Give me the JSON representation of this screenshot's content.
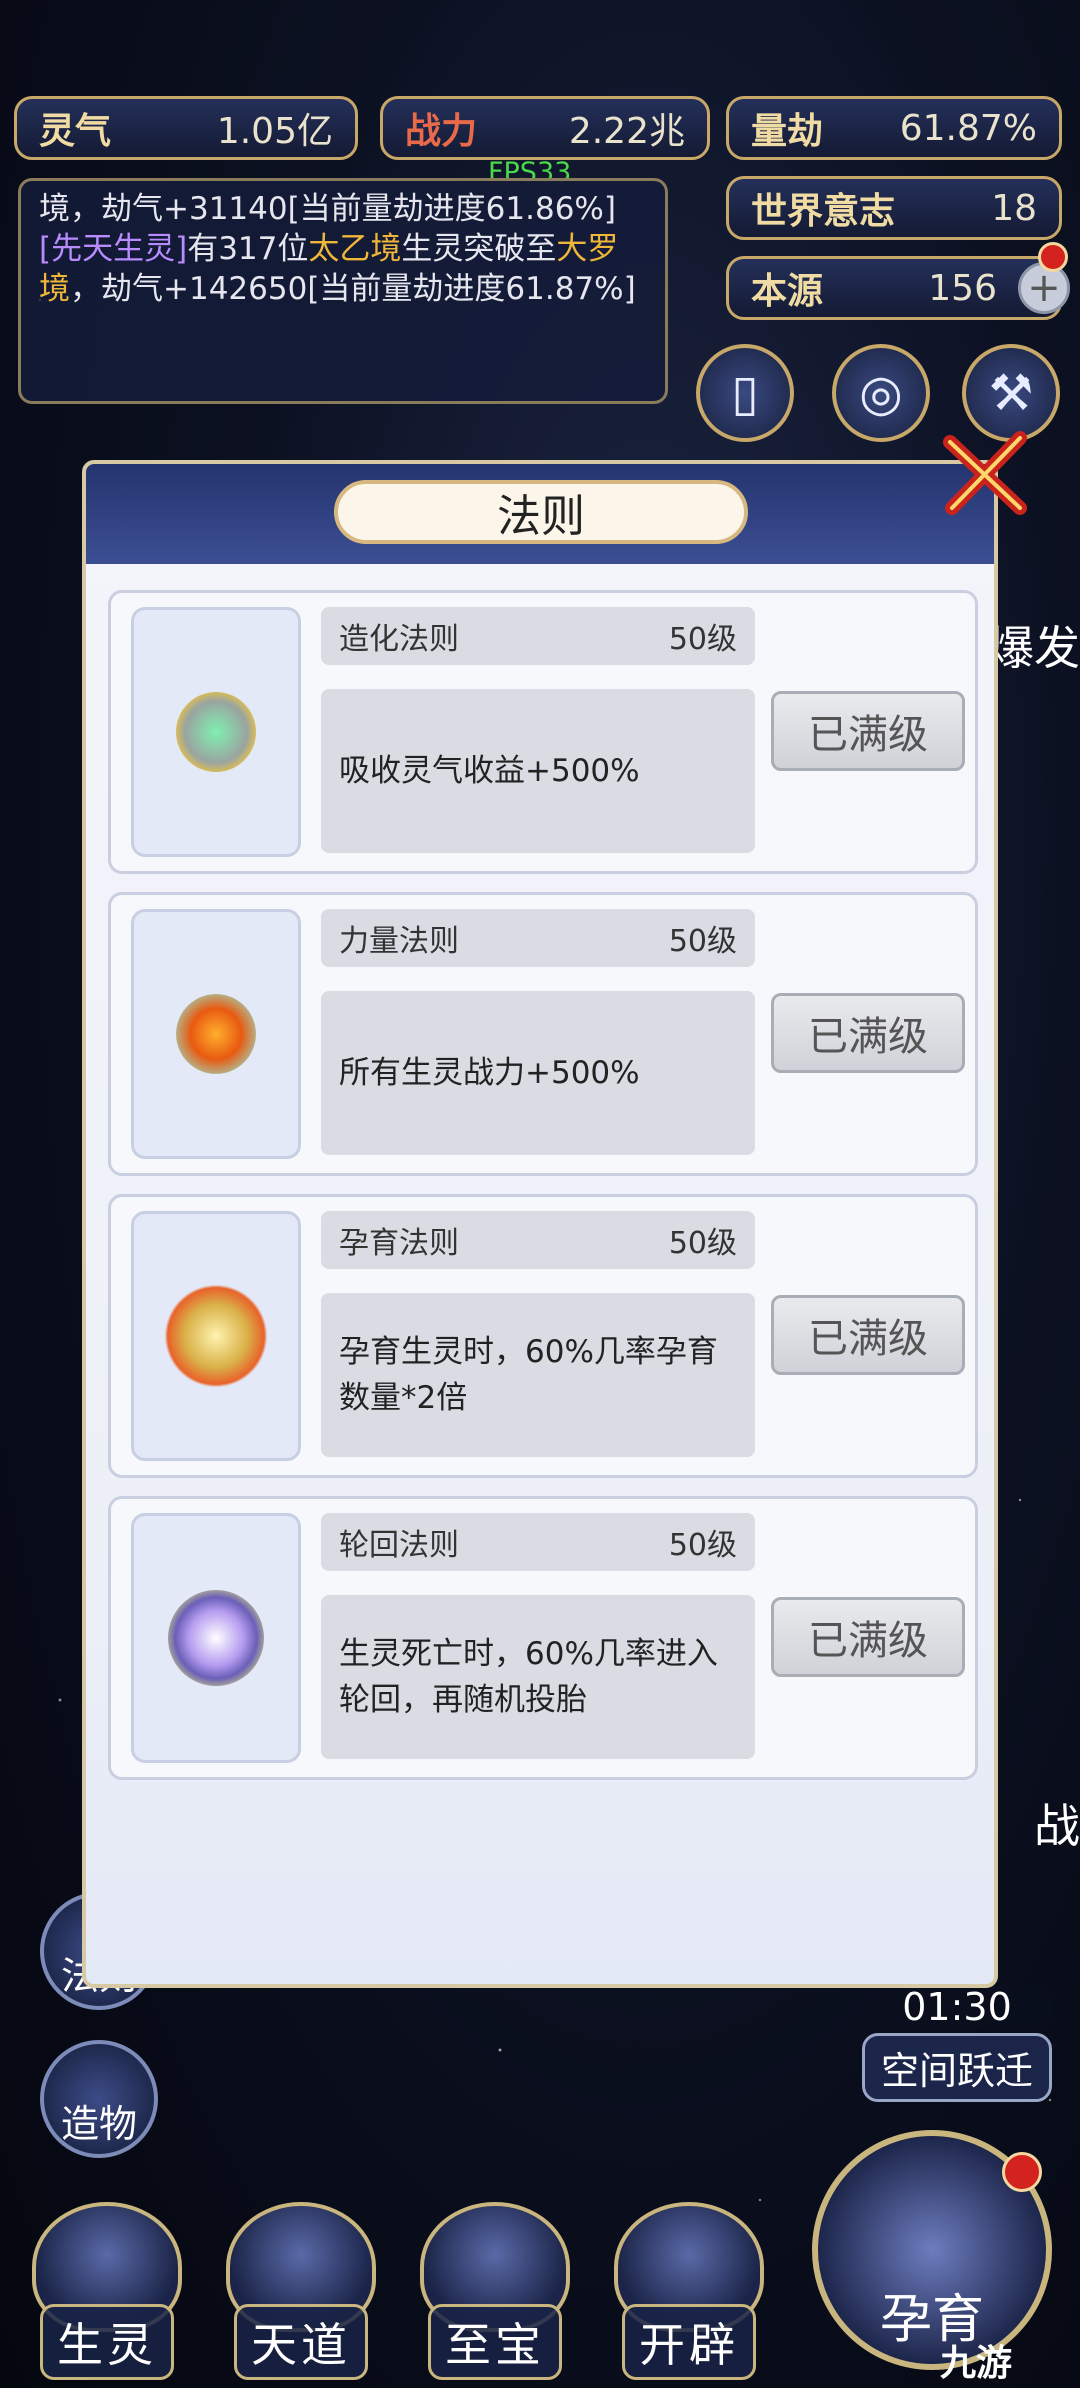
{
  "hud": {
    "lingqi": {
      "label": "灵气",
      "value": "1.05亿"
    },
    "zhanli": {
      "label": "战力",
      "value": "2.22兆"
    },
    "liangjie": {
      "label": "量劫",
      "value": "61.87%"
    },
    "shijie": {
      "label": "世界意志",
      "value": "18"
    },
    "benyuan": {
      "label": "本源",
      "value": "156"
    },
    "fps": "FPS33"
  },
  "log": {
    "line1": "境，劫气+31140[当前量劫进度61.86%]",
    "line2_tag": "[先天生灵]",
    "line2_a": "有317位",
    "line2_b": "太乙境",
    "line2_c": "生灵突破至",
    "line2_d": "大罗境",
    "line2_e": "，劫气+142650[当前量劫进度61.87%]"
  },
  "panel": {
    "title": "法则",
    "max_label": "已满级",
    "laws": [
      {
        "name": "造化法则",
        "level": "50级",
        "desc": "吸收灵气收益+500%"
      },
      {
        "name": "力量法则",
        "level": "50级",
        "desc": "所有生灵战力+500%"
      },
      {
        "name": "孕育法则",
        "level": "50级",
        "desc": "孕育生灵时，60%几率孕育数量*2倍"
      },
      {
        "name": "轮回法则",
        "level": "50级",
        "desc": "生灵死亡时，60%几率进入轮回，再随机投胎"
      }
    ]
  },
  "side": {
    "fazhe": "法则",
    "zaowu": "造物",
    "baofa": "爆发",
    "zhan": "战"
  },
  "timer": {
    "time": "01:30",
    "label": "空间跃迁"
  },
  "bottom": [
    "生灵",
    "天道",
    "至宝",
    "开辟"
  ],
  "big_button": "孕育",
  "watermark": "九游"
}
